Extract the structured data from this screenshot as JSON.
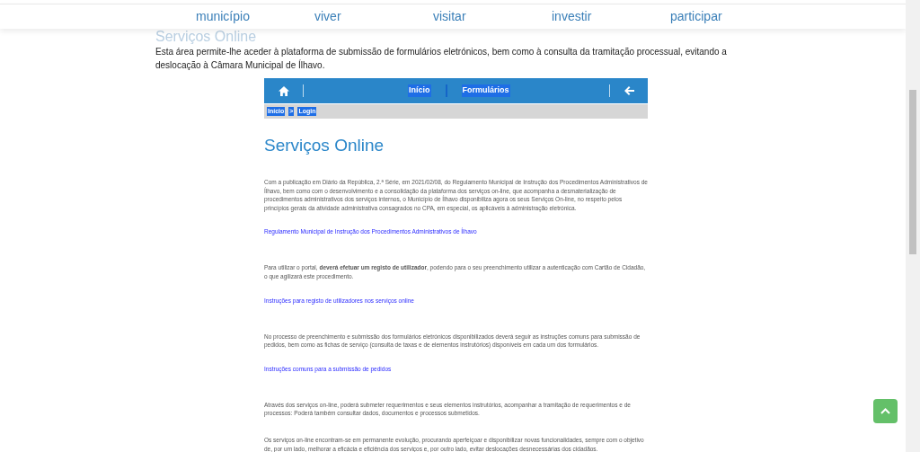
{
  "header": {
    "nav": [
      {
        "label": "município"
      },
      {
        "label": "viver"
      },
      {
        "label": "visitar"
      },
      {
        "label": "investir"
      },
      {
        "label": "participar"
      }
    ]
  },
  "page_title": "Serviços Online",
  "intro": "Esta área permite-lhe aceder à plataforma de submissão de formulários eletrónicos, bem como à consulta da tramitação processual, evitando a deslocação à Câmara Municipal de Ílhavo.",
  "embedded": {
    "toolbar": {
      "links": [
        {
          "label": "Início",
          "highlighted": true
        },
        {
          "label": "Formulários",
          "highlighted": true
        }
      ]
    },
    "breadcrumb": [
      {
        "label": "Início"
      },
      {
        "label": ">"
      },
      {
        "label": "Login"
      }
    ],
    "title": "Serviços Online",
    "blocks": [
      {
        "kind": "paragraph",
        "text": "Com a publicação em Diário da República, 2.ª Série, em 2021/02/08, do Regulamento Municipal de Instrução dos Procedimentos Administrativos de Ílhavo, bem como com o desenvolvimento e a consolidação da plataforma dos serviços on-line, que acompanha a desmaterialização de procedimentos administrativos dos serviços internos, o Município de Ílhavo disponibiliza agora os seus Serviços On-line, no respeito pelos princípios gerais da atividade administrativa consagrados no CPA, em especial, os aplicáveis à administração eletrónica."
      },
      {
        "kind": "link",
        "text": "Regulamento Municipal de Instrução dos Procedimentos Administrativos de Ílhavo"
      },
      {
        "kind": "paragraph",
        "text": "Para utilizar o portal, **deverá efetuar um registo de utilizador**, podendo para o seu preenchimento utilizar a autenticação com Cartão de Cidadão, o que agilizará este procedimento."
      },
      {
        "kind": "link",
        "text": "Instruções para registo de utilizadores nos serviços online"
      },
      {
        "kind": "paragraph",
        "text": "No processo de preenchimento e submissão dos formulários eletrónicos disponibilizados deverá seguir as instruções comuns para submissão de pedidos, bem como as fichas de serviço (consulta de taxas e de elementos instrutórios) disponíveis em cada um dos formulários."
      },
      {
        "kind": "link",
        "text": "Instruções comuns para a submissão de pedidos"
      },
      {
        "kind": "paragraph",
        "text": "Através dos serviços on-line, poderá submeter requerimentos e seus elementos instrutórios, acompanhar a tramitação de requerimentos e de processos: Poderá também consultar dados, documentos e processos submetidos."
      },
      {
        "kind": "paragraph",
        "text": "Os serviços on-line encontram-se em permanente evolução, procurando aperfeiçoar e disponibilizar novas funcionalidades, sempre com o objetivo de, por um lado, melhorar a eficácia e eficiência dos serviços e, por outro lado, evitar deslocações desnecessárias dos cidadãos."
      }
    ]
  }
}
